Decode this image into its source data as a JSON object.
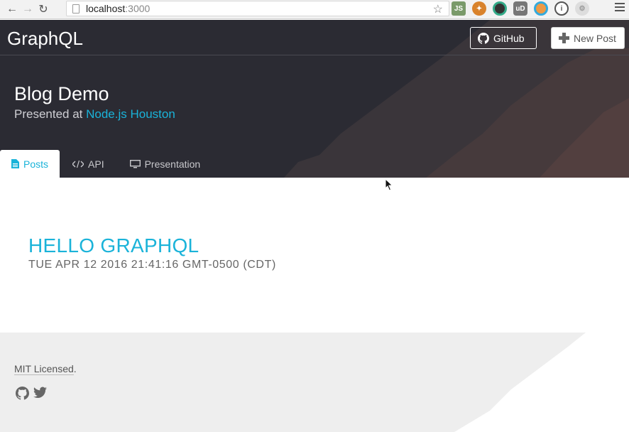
{
  "browser": {
    "url_host": "localhost",
    "url_port": ":3000"
  },
  "header": {
    "brand": "GraphQL",
    "github_label": "GitHub",
    "new_post_label": "New Post",
    "title": "Blog Demo",
    "subtitle_prefix": "Presented at ",
    "subtitle_link": "Node.js Houston"
  },
  "tabs": [
    {
      "label": "Posts",
      "icon": "file-icon",
      "active": true
    },
    {
      "label": "API",
      "icon": "code-icon",
      "active": false
    },
    {
      "label": "Presentation",
      "icon": "monitor-icon",
      "active": false
    }
  ],
  "post": {
    "title": "HELLO GRAPHQL",
    "date": "TUE APR 12 2016 21:41:16 GMT-0500 (CDT)"
  },
  "footer": {
    "license_link": "MIT Licensed",
    "license_period": "."
  },
  "colors": {
    "header_bg": "#2b2b33",
    "accent": "#1ab3d9",
    "footer_bg": "#eeeeee"
  }
}
